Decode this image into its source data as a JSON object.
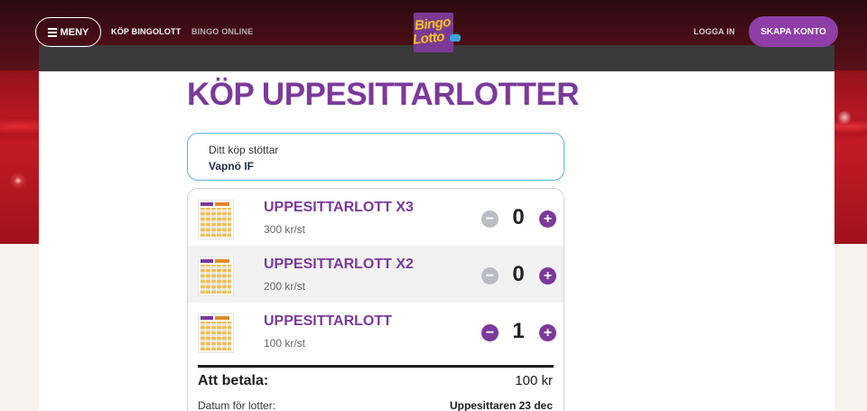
{
  "header": {
    "menu_label": "MENY",
    "nav": {
      "buy": "KÖP BINGOLOTT",
      "online": "BINGO ONLINE"
    },
    "logo": {
      "line1": "Bingo",
      "line2": "Lotto"
    },
    "login": "LOGGA IN",
    "signup": "SKAPA KONTO"
  },
  "page": {
    "title": "KÖP UPPESITTARLOTTER"
  },
  "support": {
    "label": "Ditt köp stöttar",
    "club": "Vapnö IF"
  },
  "products": [
    {
      "name": "UPPESITTARLOTT X3",
      "price": "300 kr/st",
      "qty": "0"
    },
    {
      "name": "UPPESITTARLOTT X2",
      "price": "200 kr/st",
      "qty": "0"
    },
    {
      "name": "UPPESITTARLOTT",
      "price": "100 kr/st",
      "qty": "1"
    }
  ],
  "summary": {
    "pay_label": "Att betala:",
    "pay_value": "100 kr",
    "date_label": "Datum för lotter:",
    "date_value": "Uppesittaren 23 dec"
  },
  "colors": {
    "brand_purple": "#7b3a9a",
    "accent_blue": "#5bb5e8",
    "logo_yellow": "#f6c21c"
  },
  "icons": {
    "menu": "hamburger-icon",
    "minus": "minus-circle-icon",
    "plus": "plus-circle-icon"
  }
}
